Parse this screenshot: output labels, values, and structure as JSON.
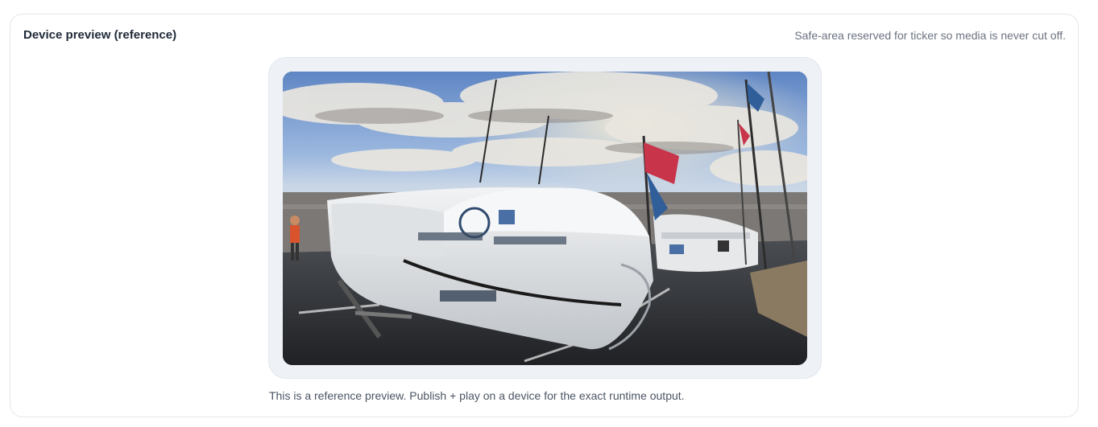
{
  "panel": {
    "title": "Device preview (reference)",
    "hint": "Safe-area reserved for ticker so media is never cut off.",
    "caption": "This is a reference preview. Publish + play on a device for the exact runtime output."
  },
  "media": {
    "subject": "photo-boats-harbour"
  },
  "colors": {
    "card_border": "#e5e7eb",
    "frame_bg": "#eef1f6",
    "title": "#1f2937",
    "muted": "#6b7280"
  }
}
